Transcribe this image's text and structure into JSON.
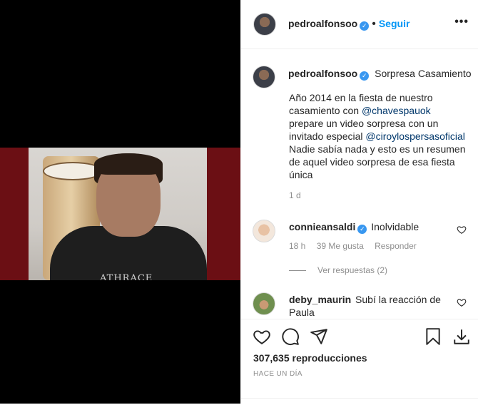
{
  "header": {
    "username": "pedroalfonsoo",
    "verified_glyph": "✓",
    "separator": "•",
    "follow_label": "Seguir",
    "more_label": "•••"
  },
  "caption": {
    "username": "pedroalfonsoo",
    "title": "Sorpresa Casamiento",
    "line1": "Año 2014 en la fiesta de nuestro",
    "line2_prefix": "casamiento con ",
    "mention1": "@chavespauok",
    "line3": "prepare un video sorpresa con un",
    "line4_prefix": "invitado especial ",
    "mention2": "@ciroylospersasoficial",
    "line5": "Nadie sabía nada y esto es un resumen",
    "line6": "de aquel video sorpresa de esa fiesta",
    "line7": "única",
    "time": "1 d"
  },
  "comments": [
    {
      "username": "connieansaldi",
      "text": "Inolvidable",
      "time": "18 h",
      "likes": "39 Me gusta",
      "reply_label": "Responder",
      "view_replies": "Ver respuestas (2)"
    },
    {
      "username": "deby_maurin",
      "text_line1": "Subí la reacción de",
      "text_line2": "Paula"
    }
  ],
  "video": {
    "shirt_text": "ATHRACE"
  },
  "actions": {
    "views": "307,635 reproducciones",
    "posted": "HACE UN DÍA"
  },
  "icons": {
    "like": "heart-icon",
    "comment": "comment-icon",
    "share": "paper-plane-icon",
    "save": "bookmark-icon",
    "download": "download-icon"
  }
}
